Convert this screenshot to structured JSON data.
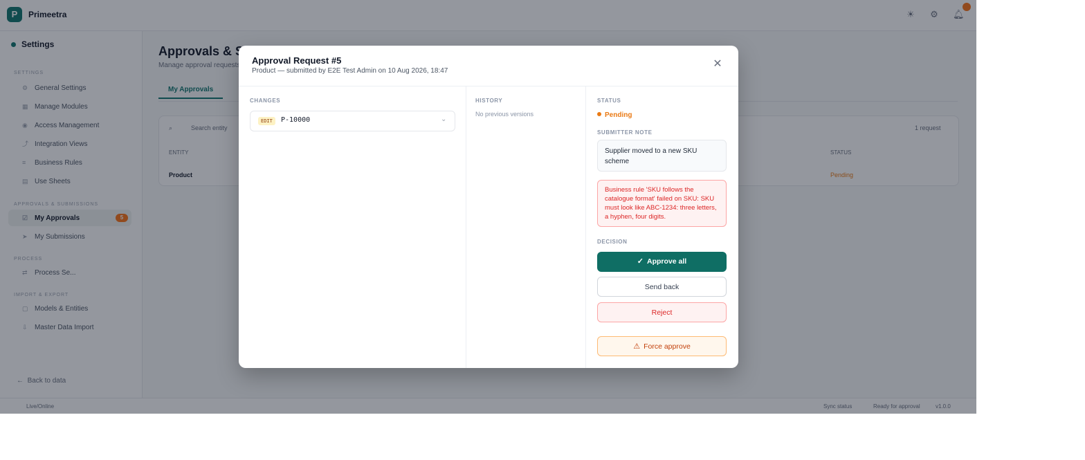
{
  "app": {
    "name": "Primeetra",
    "logo_letter": "P"
  },
  "sidebar": {
    "heading": "Settings",
    "sections": [
      {
        "label": "Settings",
        "items": [
          {
            "label": "General Settings",
            "icon": "gear-icon"
          },
          {
            "label": "Manage Modules",
            "icon": "grid-icon"
          },
          {
            "label": "Access Management",
            "icon": "user-icon"
          },
          {
            "label": "Integration Views",
            "icon": "link-icon"
          },
          {
            "label": "Business Rules",
            "icon": "rule-icon"
          },
          {
            "label": "Use Sheets",
            "icon": "sheet-icon"
          }
        ]
      },
      {
        "label": "Approvals & Submissions",
        "items": [
          {
            "label": "My Approvals",
            "icon": "check-icon",
            "active": true,
            "count": "5"
          },
          {
            "label": "My Submissions",
            "icon": "send-icon"
          }
        ]
      },
      {
        "label": "Process",
        "items": [
          {
            "label": "Process Se...",
            "icon": "flow-icon"
          }
        ]
      },
      {
        "label": "Import & Export",
        "items": [
          {
            "label": "Models & Entities",
            "icon": "box-icon"
          },
          {
            "label": "Master Data Import",
            "icon": "import-icon"
          }
        ]
      }
    ],
    "back_label": "Back to data"
  },
  "statusbar": {
    "left": "Live/Online",
    "right1": "Sync status",
    "right2": "Ready for approval",
    "right3": "v1.0.0"
  },
  "page": {
    "title": "Approvals & Submissions",
    "subtitle": "Manage approval requests",
    "tab_label": "My Approvals",
    "search_placeholder": "Search entity",
    "count_label": "1 request",
    "table": {
      "col_entity": "ENTITY",
      "col_status": "STATUS",
      "row_entity": "Product",
      "row_status": "Pending"
    }
  },
  "modal": {
    "title": "Approval Request #5",
    "subtitle": "Product — submitted by E2E Test Admin on 10 Aug 2026, 18:47",
    "changes_label": "CHANGES",
    "change_badge": "EDIT",
    "change_code": "P-10000",
    "history_label": "HISTORY",
    "history_empty": "No previous versions",
    "status_label": "STATUS",
    "status_value": "Pending",
    "note_label": "SUBMITTER NOTE",
    "note_text": "Supplier moved to a new SKU scheme",
    "error_text": "Business rule 'SKU follows the catalogue format' failed on SKU: SKU must look like ABC-1234: three letters, a hyphen, four digits.",
    "decision_label": "DECISION",
    "approve_label": "Approve all",
    "send_back_label": "Send back",
    "reject_label": "Reject",
    "force_label": "Force approve"
  },
  "colors": {
    "brand": "#0f6e64",
    "pending": "#ea7a14",
    "danger": "#dc2626",
    "warning": "#c2410c"
  }
}
